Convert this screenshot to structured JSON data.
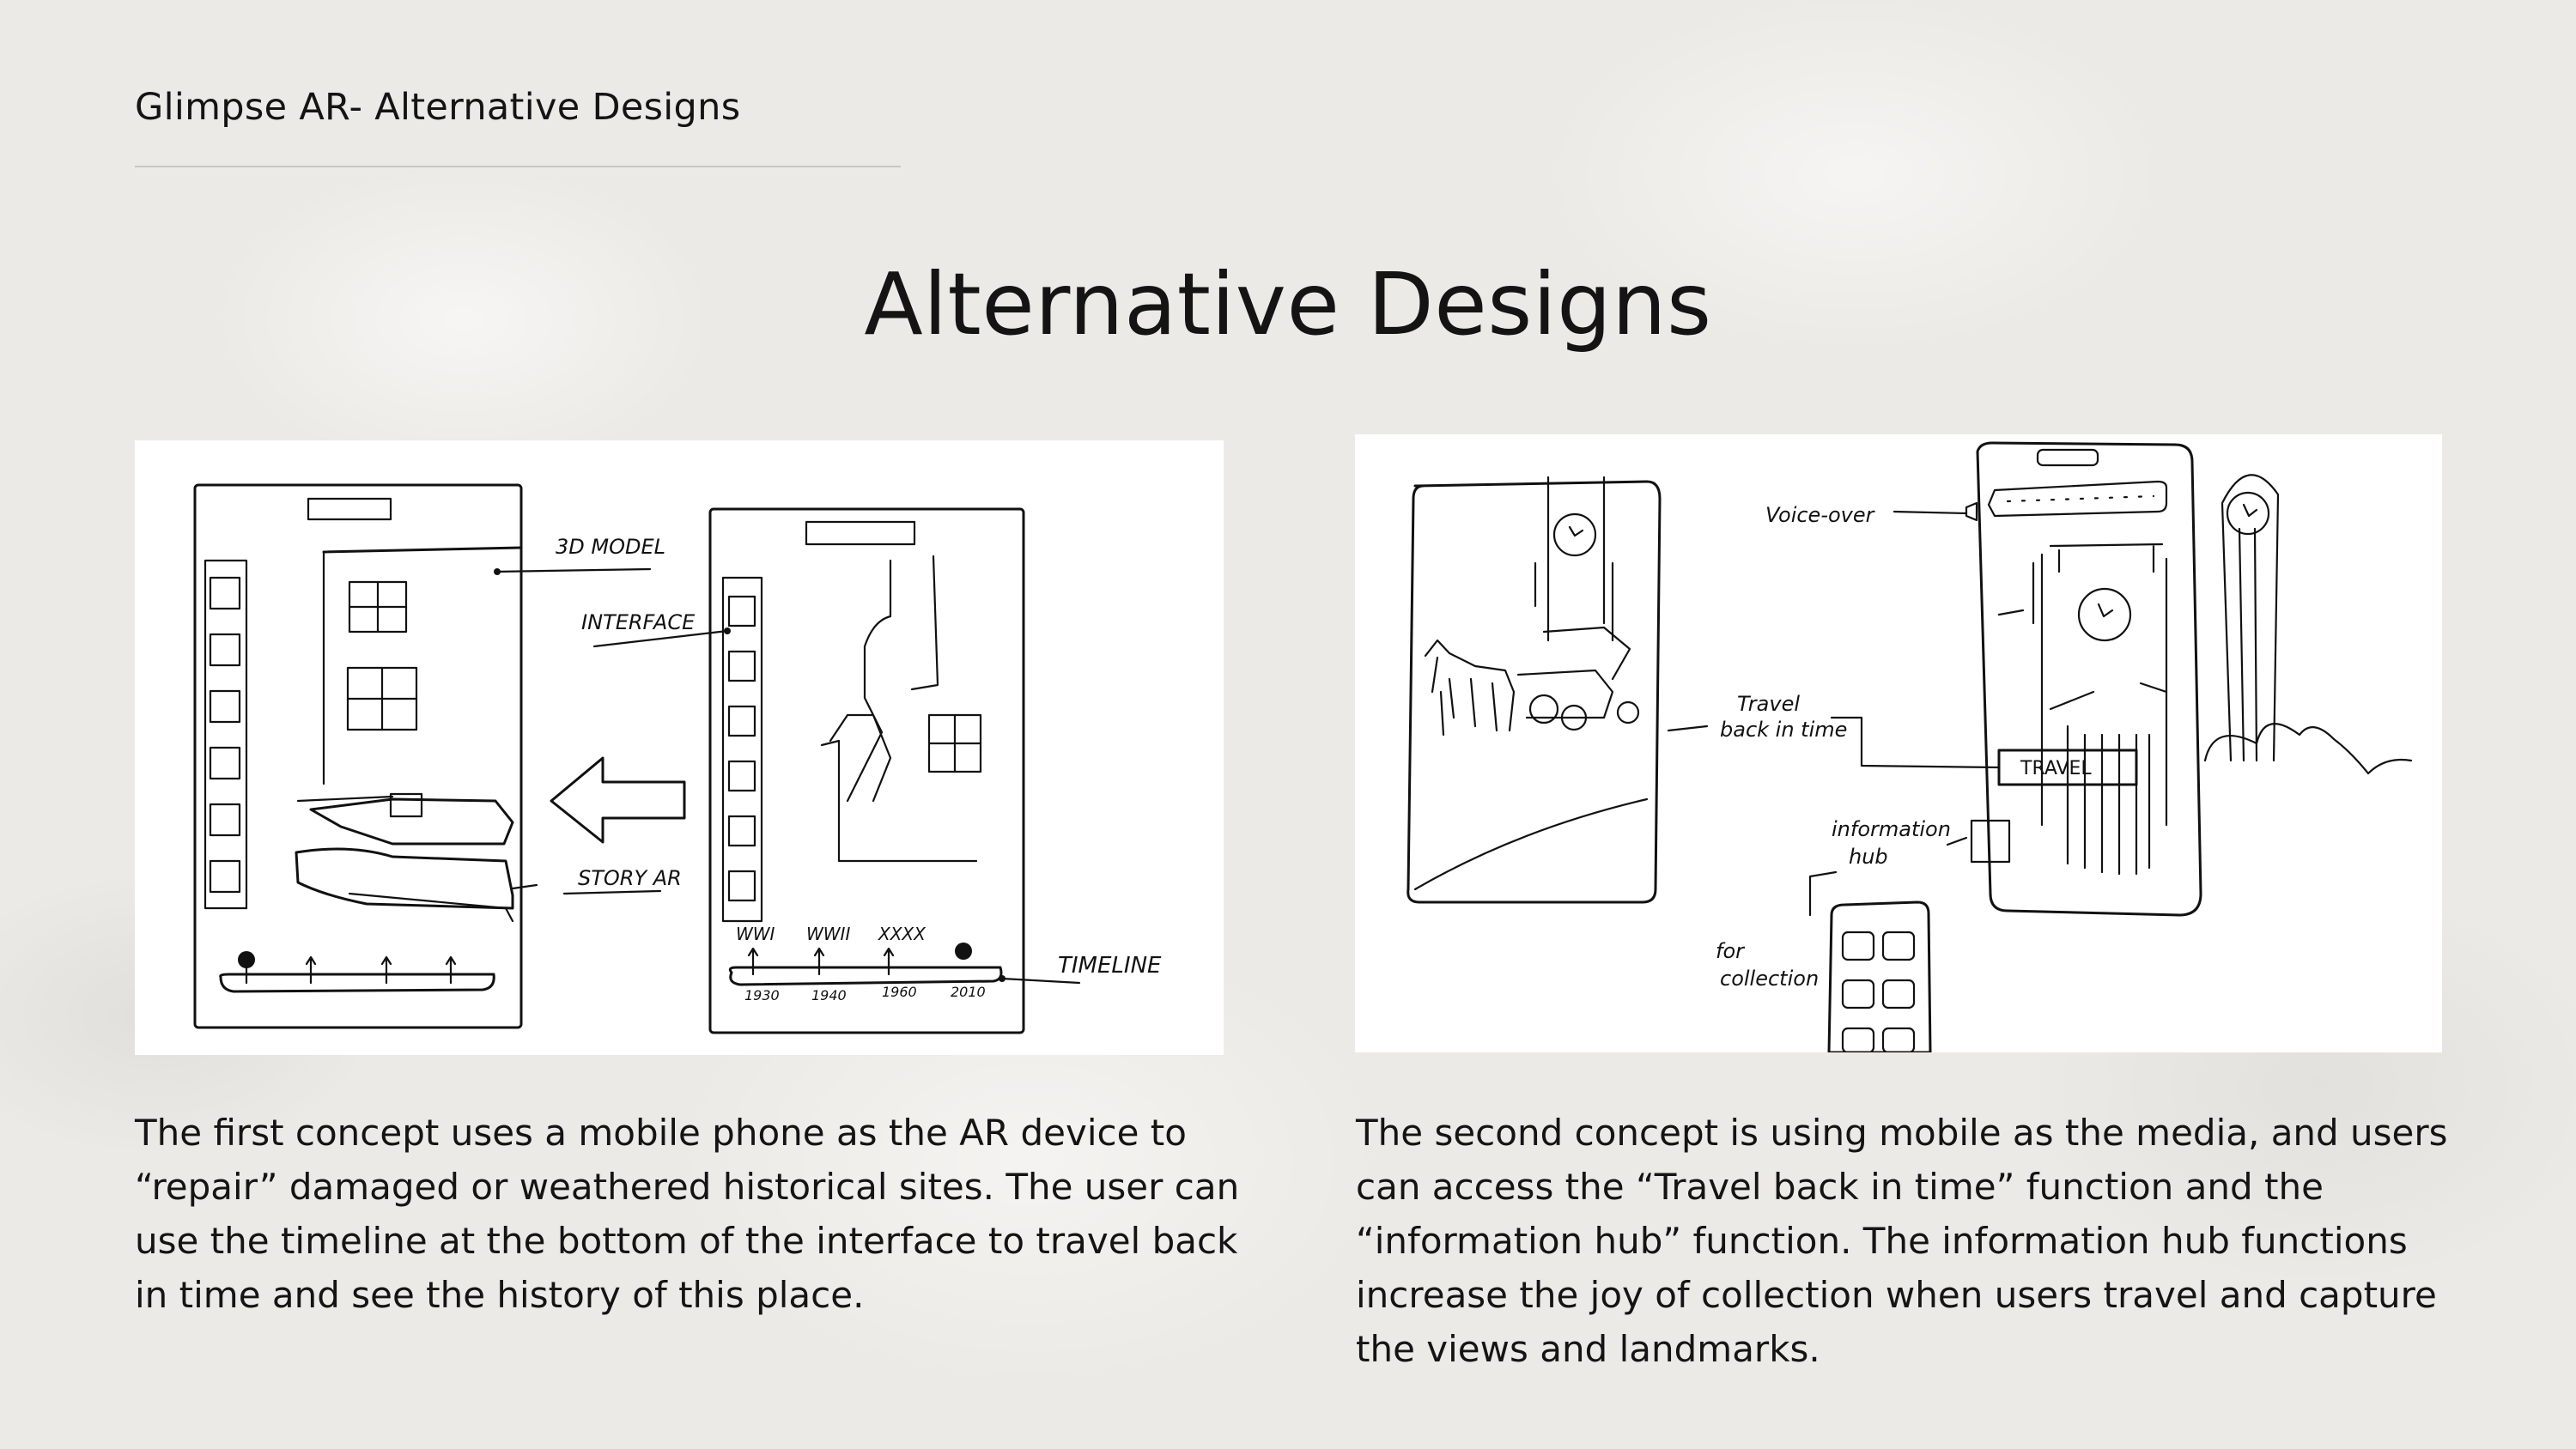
{
  "header": {
    "title": "Glimpse AR- Alternative Designs"
  },
  "main": {
    "title": "Alternative Designs"
  },
  "concepts": [
    {
      "sketch_labels": {
        "model": "3D MODEL",
        "interface": "INTERFACE",
        "story": "STORY AR",
        "timeline": "TIMELINE",
        "era1": "WWI",
        "era2": "WWII",
        "era3": "XXXX",
        "year1": "1930",
        "year2": "1940",
        "year3": "1960",
        "year4": "2010"
      },
      "description": "The first concept uses a mobile phone as the AR device to “repair” damaged or weathered historical sites. The user can use the timeline at the bottom of the interface to travel back in time and see the history of this place."
    },
    {
      "sketch_labels": {
        "voice": "Voice-over",
        "travel_1": "Travel",
        "travel_2": "back in time",
        "travel_button": "TRAVEL",
        "info_1": "information",
        "info_2": "hub",
        "collect_1": "for",
        "collect_2": "collection"
      },
      "description": "The second concept is using mobile as the media, and users can access the “Travel back in time” function and the “information hub” function. The information hub functions increase the joy of collection when users travel and capture the views and landmarks."
    }
  ]
}
